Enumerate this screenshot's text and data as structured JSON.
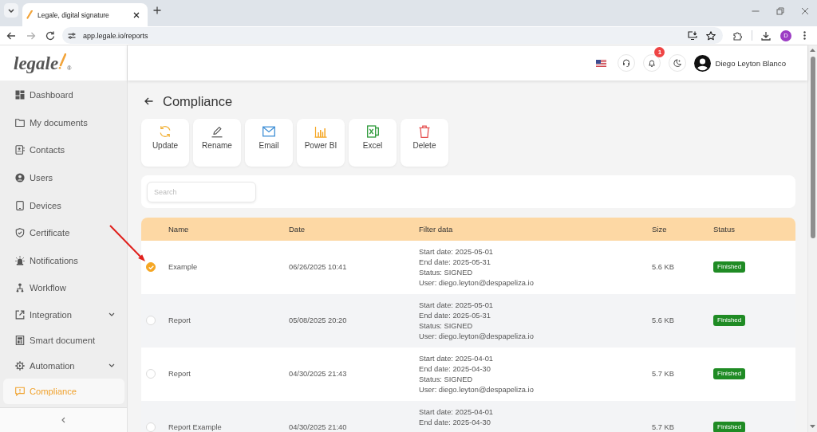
{
  "browser": {
    "tab": {
      "title": "Legale, digital signature"
    },
    "address": "app.legale.io/reports",
    "profile_initial": "D"
  },
  "sidebar": {
    "logo": {
      "wordmark": "legale",
      "mark": "®"
    },
    "items": [
      {
        "label": "Dashboard",
        "kind": "dashboard",
        "selected": false
      },
      {
        "label": "My documents",
        "kind": "documents",
        "selected": false
      },
      {
        "label": "Contacts",
        "kind": "contacts",
        "selected": false
      },
      {
        "label": "Users",
        "kind": "users",
        "selected": false
      },
      {
        "label": "Devices",
        "kind": "devices",
        "selected": false
      },
      {
        "label": "Certificate",
        "kind": "certificate",
        "selected": false
      },
      {
        "label": "Notifications",
        "kind": "notifications",
        "selected": false
      },
      {
        "label": "Workflow",
        "kind": "workflow",
        "selected": false
      },
      {
        "label": "Integration",
        "kind": "integration",
        "selected": false,
        "expanded": false
      },
      {
        "label": "Smart document",
        "kind": "smart_document",
        "selected": false
      },
      {
        "label": "Automation",
        "kind": "automation",
        "selected": false,
        "expanded": false
      },
      {
        "label": "Compliance",
        "kind": "compliance",
        "selected": true
      }
    ]
  },
  "header": {
    "notification_count": "1",
    "user_name": "Diego Leyton Blanco"
  },
  "page": {
    "title": "Compliance",
    "actions": [
      {
        "label": "Update",
        "kind": "update"
      },
      {
        "label": "Rename",
        "kind": "rename"
      },
      {
        "label": "Email",
        "kind": "email"
      },
      {
        "label": "Power BI",
        "kind": "power_bi"
      },
      {
        "label": "Excel",
        "kind": "excel"
      },
      {
        "label": "Delete",
        "kind": "delete"
      }
    ],
    "search": {
      "placeholder": "Search"
    },
    "table": {
      "columns": [
        "Name",
        "Date",
        "Filter data",
        "Size",
        "Status"
      ],
      "rows": [
        {
          "selected": true,
          "name": "Example",
          "date": "06/26/2025 10:41",
          "filter_data": [
            "Start date: 2025-05-01",
            "End date: 2025-05-31",
            "Status: SIGNED",
            "User: diego.leyton@despapeliza.io"
          ],
          "size": "5.6 KB",
          "status": "Finished"
        },
        {
          "selected": false,
          "name": "Report",
          "date": "05/08/2025 20:20",
          "filter_data": [
            "Start date: 2025-05-01",
            "End date: 2025-05-31",
            "Status: SIGNED",
            "User: diego.leyton@despapeliza.io"
          ],
          "size": "5.6 KB",
          "status": "Finished"
        },
        {
          "selected": false,
          "name": "Report",
          "date": "04/30/2025 21:43",
          "filter_data": [
            "Start date: 2025-04-01",
            "End date: 2025-04-30",
            "Status: SIGNED",
            "User: diego.leyton@despapeliza.io"
          ],
          "size": "5.7 KB",
          "status": "Finished"
        },
        {
          "selected": false,
          "name": "Report Example",
          "date": "04/30/2025 21:40",
          "filter_data": [
            "Start date: 2025-04-01",
            "End date: 2025-04-30"
          ],
          "size": "5.7 KB",
          "status": "Finished"
        }
      ]
    }
  }
}
